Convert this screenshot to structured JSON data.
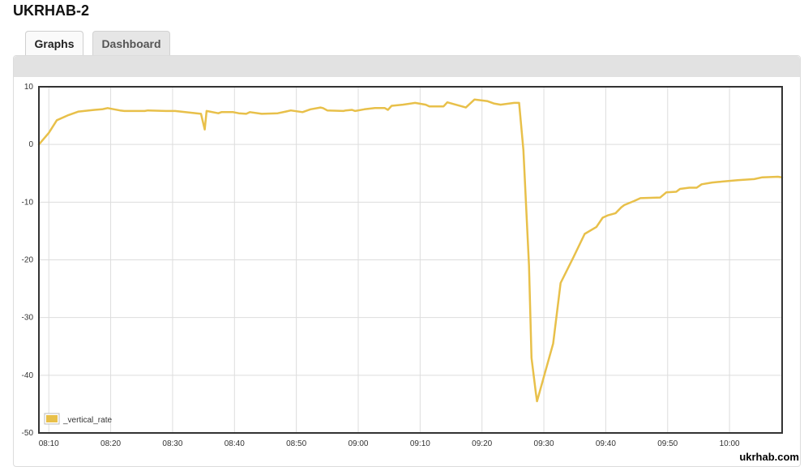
{
  "page": {
    "title": "UKRHAB-2"
  },
  "tabs": [
    {
      "label": "Graphs",
      "active": true
    },
    {
      "label": "Dashboard",
      "active": false
    }
  ],
  "watermark": "ukrhab.com",
  "chart_data": {
    "type": "line",
    "title": "",
    "xlabel": "",
    "ylabel": "",
    "grid": true,
    "legend_position": "bottom-left",
    "x_unit": "minutes since 08:00",
    "xlim": [
      8.4,
      128.5
    ],
    "ylim": [
      -50,
      10
    ],
    "x_ticks": [
      {
        "x": 10,
        "label": "08:10"
      },
      {
        "x": 20,
        "label": "08:20"
      },
      {
        "x": 30,
        "label": "08:30"
      },
      {
        "x": 40,
        "label": "08:40"
      },
      {
        "x": 50,
        "label": "08:50"
      },
      {
        "x": 60,
        "label": "09:00"
      },
      {
        "x": 70,
        "label": "09:10"
      },
      {
        "x": 80,
        "label": "09:20"
      },
      {
        "x": 90,
        "label": "09:30"
      },
      {
        "x": 100,
        "label": "09:40"
      },
      {
        "x": 110,
        "label": "09:50"
      },
      {
        "x": 120,
        "label": "10:00"
      }
    ],
    "y_ticks": [
      10,
      0,
      -10,
      -20,
      -30,
      -40,
      -50
    ],
    "series": [
      {
        "name": "_vertical_rate",
        "color": "#e8c04a",
        "points": [
          [
            8.4,
            0.0
          ],
          [
            10.0,
            2.0
          ],
          [
            11.3,
            4.2
          ],
          [
            13.2,
            5.1
          ],
          [
            14.8,
            5.7
          ],
          [
            17.4,
            6.0
          ],
          [
            18.6,
            6.1
          ],
          [
            19.5,
            6.3
          ],
          [
            21.5,
            5.9
          ],
          [
            22.2,
            5.8
          ],
          [
            25.5,
            5.8
          ],
          [
            26.0,
            5.9
          ],
          [
            28.9,
            5.8
          ],
          [
            30.4,
            5.8
          ],
          [
            34.6,
            5.3
          ],
          [
            35.2,
            2.6
          ],
          [
            35.5,
            5.8
          ],
          [
            37.4,
            5.4
          ],
          [
            37.9,
            5.6
          ],
          [
            39.8,
            5.6
          ],
          [
            40.7,
            5.4
          ],
          [
            41.9,
            5.3
          ],
          [
            42.5,
            5.6
          ],
          [
            44.4,
            5.3
          ],
          [
            47.0,
            5.4
          ],
          [
            48.3,
            5.7
          ],
          [
            49.1,
            5.9
          ],
          [
            51.0,
            5.6
          ],
          [
            52.3,
            6.1
          ],
          [
            53.9,
            6.4
          ],
          [
            54.3,
            6.3
          ],
          [
            55.0,
            5.9
          ],
          [
            57.6,
            5.8
          ],
          [
            58.0,
            5.9
          ],
          [
            59.0,
            6.0
          ],
          [
            59.5,
            5.8
          ],
          [
            61.0,
            6.1
          ],
          [
            62.7,
            6.3
          ],
          [
            64.3,
            6.3
          ],
          [
            64.8,
            6.0
          ],
          [
            65.4,
            6.7
          ],
          [
            67.2,
            6.9
          ],
          [
            69.2,
            7.2
          ],
          [
            70.9,
            6.9
          ],
          [
            71.5,
            6.6
          ],
          [
            73.8,
            6.6
          ],
          [
            74.4,
            7.3
          ],
          [
            77.4,
            6.4
          ],
          [
            78.8,
            7.8
          ],
          [
            80.9,
            7.5
          ],
          [
            81.9,
            7.1
          ],
          [
            83.0,
            6.9
          ],
          [
            85.2,
            7.2
          ],
          [
            86.0,
            7.2
          ],
          [
            86.7,
            -1.0
          ],
          [
            87.6,
            -21.0
          ],
          [
            88.0,
            -37.0
          ],
          [
            88.7,
            -43.0
          ],
          [
            88.9,
            -44.5
          ],
          [
            91.5,
            -34.5
          ],
          [
            92.7,
            -24.0
          ],
          [
            94.8,
            -19.5
          ],
          [
            96.6,
            -15.5
          ],
          [
            98.5,
            -14.3
          ],
          [
            99.5,
            -12.7
          ],
          [
            100.3,
            -12.3
          ],
          [
            101.6,
            -11.9
          ],
          [
            102.5,
            -10.9
          ],
          [
            103.0,
            -10.5
          ],
          [
            104.6,
            -9.8
          ],
          [
            105.6,
            -9.3
          ],
          [
            108.8,
            -9.2
          ],
          [
            109.8,
            -8.3
          ],
          [
            111.4,
            -8.2
          ],
          [
            112.0,
            -7.7
          ],
          [
            113.5,
            -7.5
          ],
          [
            114.7,
            -7.5
          ],
          [
            115.5,
            -6.9
          ],
          [
            117.2,
            -6.6
          ],
          [
            118.2,
            -6.5
          ],
          [
            121.3,
            -6.2
          ],
          [
            124.0,
            -6.0
          ],
          [
            125.3,
            -5.7
          ],
          [
            127.8,
            -5.6
          ],
          [
            128.5,
            -5.7
          ]
        ]
      }
    ]
  }
}
